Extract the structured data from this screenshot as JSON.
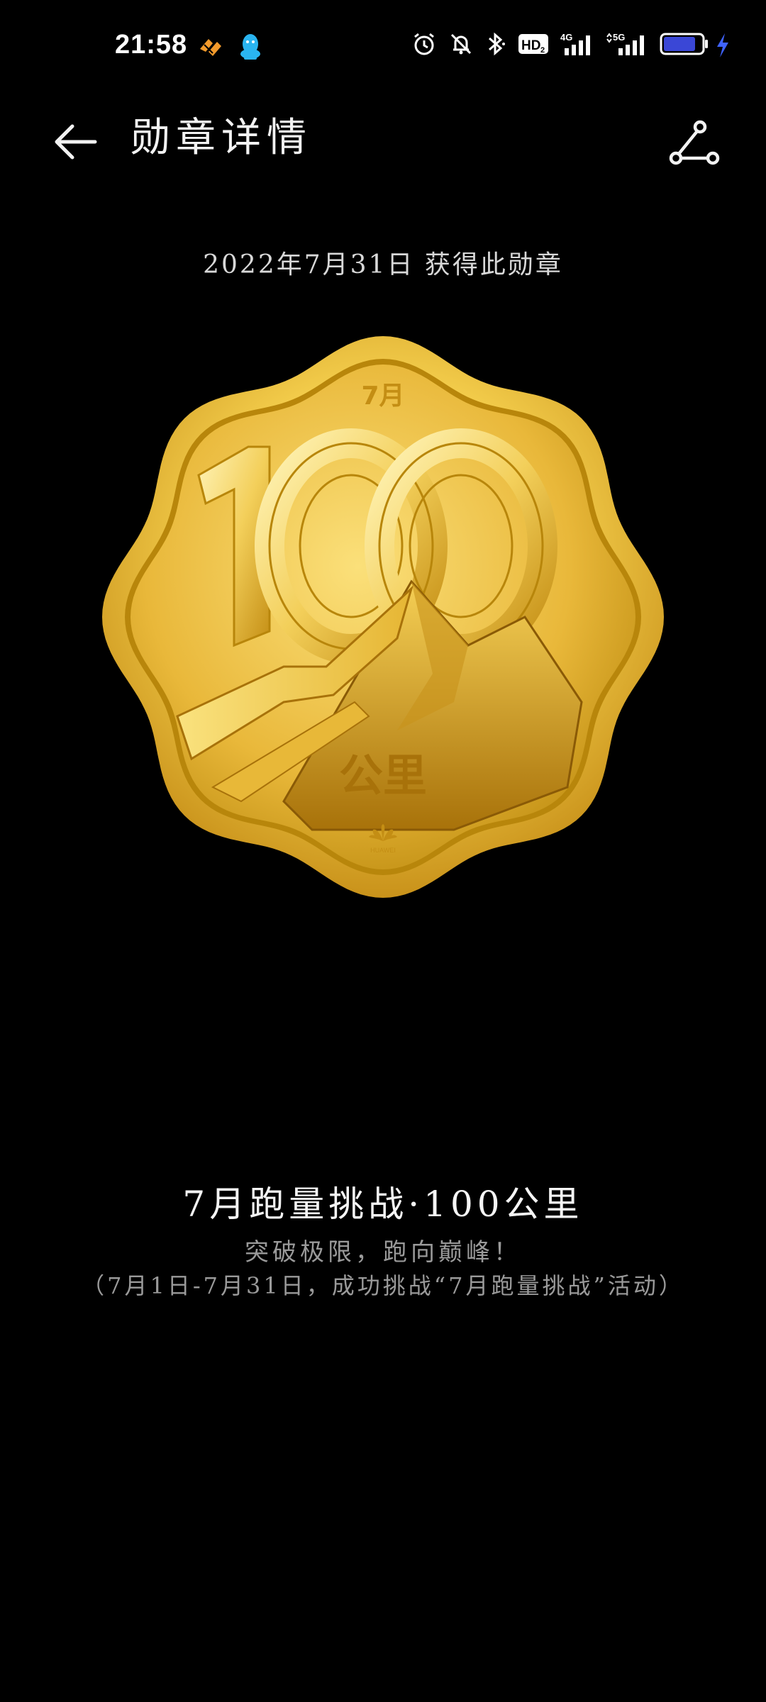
{
  "status_bar": {
    "time": "21:58",
    "network_badge_hd": "HD",
    "network_badge_hd_sub": "2",
    "network_4g": "4G",
    "network_5g": "5G",
    "icons": [
      "swirl-app-icon",
      "qq-penguin-icon",
      "alarm-icon",
      "mute-bell-icon",
      "bluetooth-icon",
      "hd-voice-icon",
      "signal-4g-icon",
      "signal-5g-icon",
      "battery-icon",
      "charging-bolt-icon"
    ],
    "battery_level": 0.85,
    "battery_color": "#3a47d6",
    "charge_color": "#3f63ff"
  },
  "header": {
    "title": "勋章详情",
    "back_icon": "arrow-left-icon",
    "share_icon": "share-icon"
  },
  "award_date": "2022年7月31日 获得此勋章",
  "medal": {
    "month_label": "7月",
    "number": "100",
    "unit": "公里",
    "brand_icon": "huawei-logo-icon",
    "brand_text": "HUAWEI",
    "colors": {
      "gold_light": "#fbe27a",
      "gold_mid": "#e6b52a",
      "gold_dark": "#b8860b",
      "gold_shadow": "#8a5a06"
    }
  },
  "badge": {
    "name": "7月跑量挑战·100公里",
    "slogan": "突破极限，跑向巅峰！",
    "description": "（7月1日-7月31日，成功挑战“7月跑量挑战”活动）"
  }
}
